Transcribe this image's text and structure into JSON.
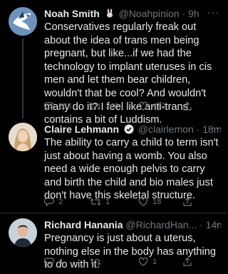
{
  "tweets": [
    {
      "name": "Noah Smith",
      "emoji": "rabbit-emoji",
      "verified": false,
      "handle": "@Noahpinion",
      "time": "· 9h",
      "text": "Conservatives regularly freak out about the idea of trans men being pregnant, but like...if we had the technology to implant uteruses in cis men and let them bear children, wouldn't that be cool? And wouldn't many do it? I feel like anti-trans contains a bit of Luddism.",
      "replies": "233",
      "retweets": "249",
      "likes": "472"
    },
    {
      "name": "Claire Lehmann",
      "verified": true,
      "handle": "@clairlemon",
      "time": "· 18m",
      "text": "The ability to carry a child to term isn't just about having a womb. You also need a wide enough pelvis to carry and birth the child and bio males just don't have this skeletal structure.",
      "replies": "2",
      "retweets": "1",
      "likes": "18"
    },
    {
      "name": "Richard Hanania",
      "verified": false,
      "handle": "@RichardHan...",
      "time": "· 14m",
      "text": "Pregnancy is just about a uterus, nothing else in the body has anything to do with it.",
      "replies": "4",
      "retweets": "",
      "likes": "1"
    }
  ],
  "colors": {
    "background": "#000000",
    "text": "#e7e9ea",
    "muted": "#71767b",
    "verified": "#1d9bf0"
  }
}
